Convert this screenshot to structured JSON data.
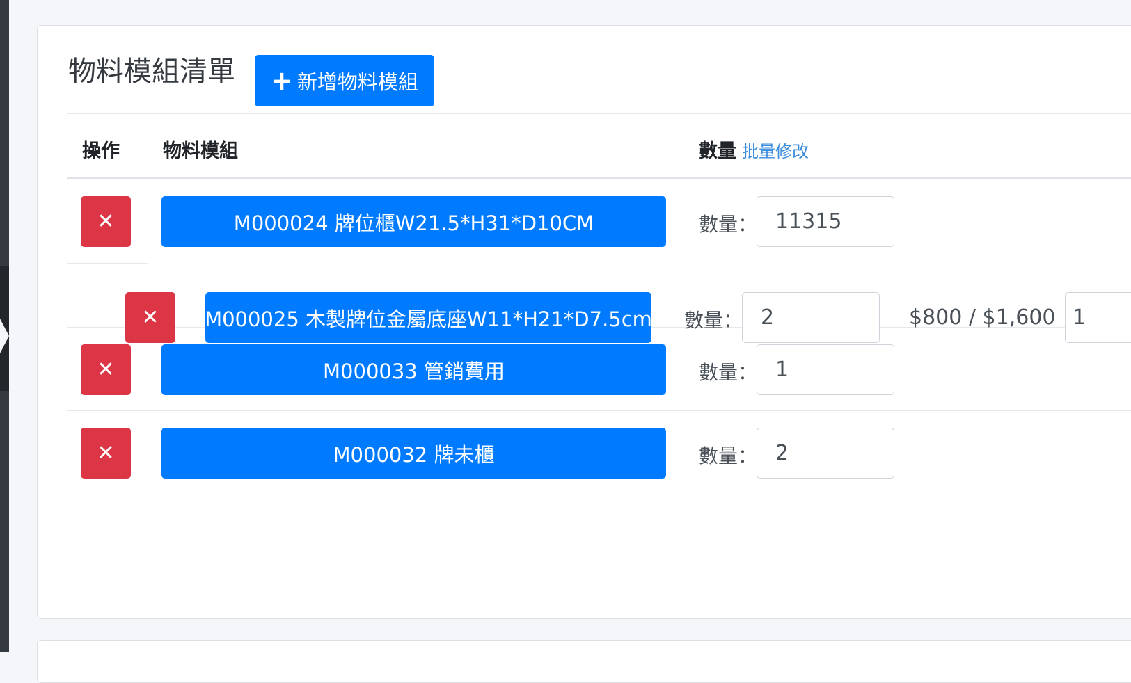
{
  "card": {
    "title": "物料模組清單",
    "add_button": {
      "icon": "plus-icon",
      "label": "新增物料模組"
    }
  },
  "table": {
    "headers": {
      "action": "操作",
      "module": "物料模組",
      "qty": "數量",
      "qty_link": "批量修改"
    }
  },
  "rows": [
    {
      "code": "M000024 牌位櫃W21.5*H31*D10CM",
      "qty_label": "數量：",
      "qty": "11315"
    },
    {
      "code": "M000025 木製牌位金屬底座W11*H21*D7.5cm",
      "qty_label": "數量：",
      "qty": "2",
      "price": "$800 / $1,600",
      "extra": "1"
    },
    {
      "code": "M000033 管銷費用",
      "qty_label": "數量：",
      "qty": "1"
    },
    {
      "code": "M000032 牌未櫃",
      "qty_label": "數量：",
      "qty": "2"
    }
  ],
  "icons": {
    "delete": "close-icon"
  },
  "colors": {
    "primary": "#007bff",
    "danger": "#dc3545",
    "link": "#3c8dde"
  }
}
